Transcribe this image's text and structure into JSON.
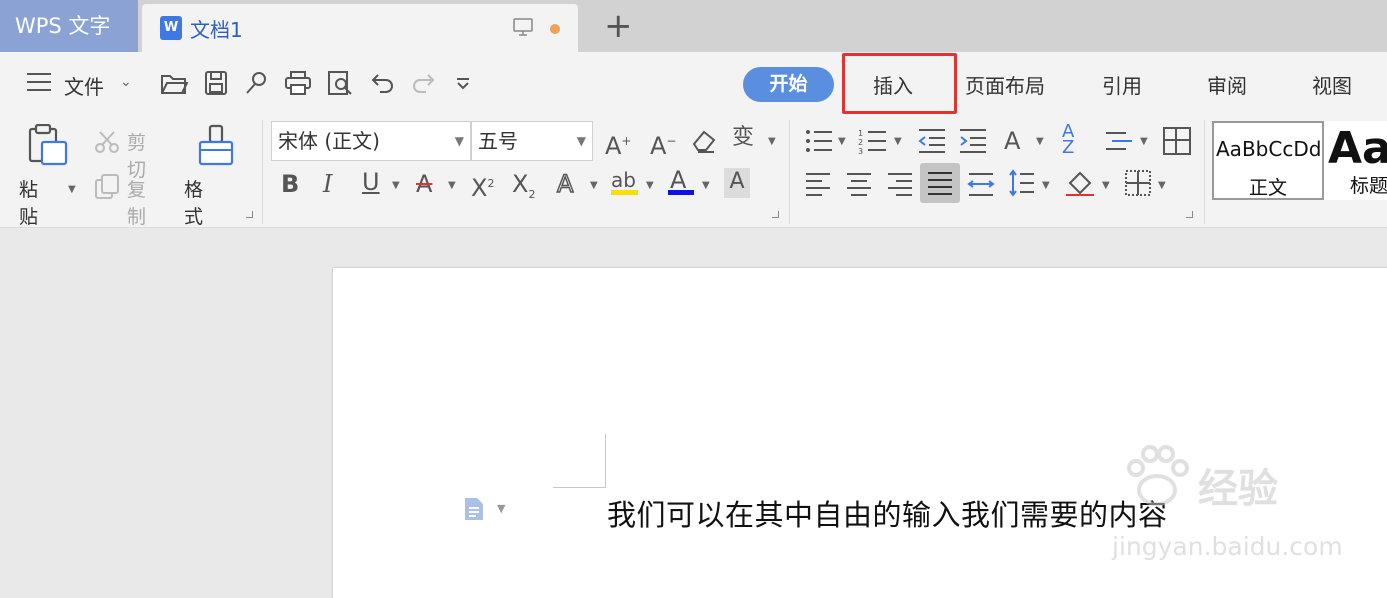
{
  "app": {
    "title": "WPS 文字"
  },
  "doc_tab": {
    "icon_letter": "W",
    "name": "文档1"
  },
  "menu": {
    "file_label": "文件",
    "tabs": [
      "开始",
      "插入",
      "页面布局",
      "引用",
      "审阅",
      "视图"
    ]
  },
  "clipboard": {
    "paste": "粘贴",
    "cut": "剪切",
    "copy": "复制",
    "format_painter": "格式刷"
  },
  "font": {
    "name": "宋体 (正文)",
    "size": "五号"
  },
  "styles": [
    {
      "sample": "AaBbCcDd",
      "name": "正文"
    },
    {
      "sample": "Aa",
      "name": "标题"
    }
  ],
  "document": {
    "body_text": "我们可以在其中自由的输入我们需要的内容"
  },
  "watermark": {
    "brand": "经验",
    "url": "jingyan.baidu.com"
  },
  "colors": {
    "accent": "#5a8fe0",
    "highlight_box": "#e23232",
    "app_tab": "#8aa3d4",
    "highlight_yellow": "#f5e000",
    "font_color_blue": "#1010e0"
  }
}
